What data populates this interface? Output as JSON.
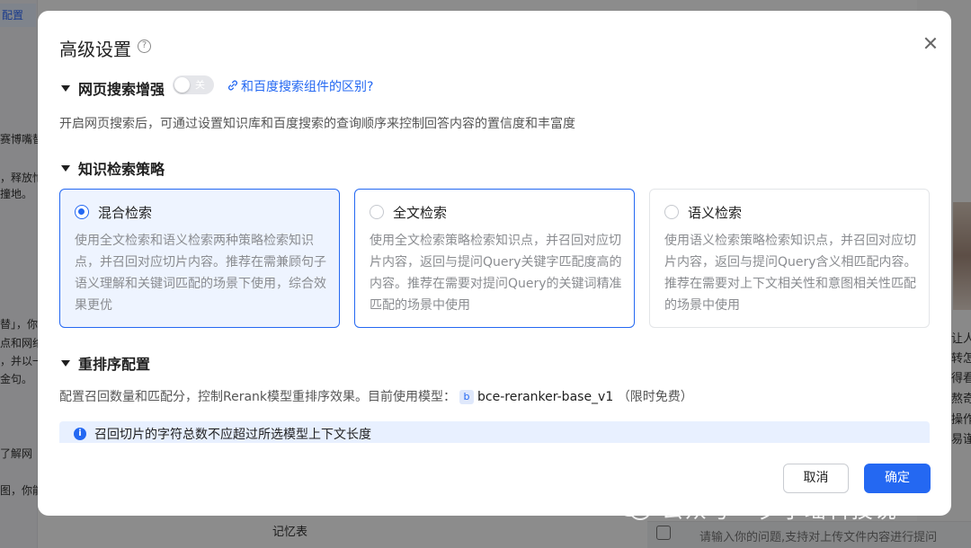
{
  "background": {
    "left_tag": "配置",
    "left_snippets": [
      "赛博嘴替",
      "，释放忙",
      "撞地。",
      "替」，你的",
      "点和网络",
      "，并以一",
      "金句。",
      "了解网",
      "图，你能"
    ],
    "right_snippets": [
      "让人",
      "转怎",
      "得看",
      "熬奇",
      "操作",
      "易谨"
    ],
    "bottom_panel_label": "记忆表",
    "bottom_input_placeholder": "请输入你的问题,支持对上传文件内容进行提问"
  },
  "modal": {
    "title": "高级设置",
    "help_icon_glyph": "?",
    "web_search": {
      "title": "网页搜索增强",
      "toggle_label": "关",
      "toggle_on": false,
      "link_text": "和百度搜索组件的区别?",
      "description": "开启网页搜索后，可通过设置知识库和百度搜索的查询顺序来控制回答内容的置信度和丰富度"
    },
    "retrieval": {
      "title": "知识检索策略",
      "options": [
        {
          "title": "混合检索",
          "selected": true,
          "description": "使用全文检索和语义检索两种策略检索知识点，并召回对应切片内容。推荐在需兼顾句子语义理解和关键词匹配的场景下使用，综合效果更优"
        },
        {
          "title": "全文检索",
          "selected": false,
          "description": "使用全文检索策略检索知识点，并召回对应切片内容，返回与提问Query关键字匹配度高的内容。推荐在需要对提问Query的关键词精准匹配的场景中使用"
        },
        {
          "title": "语义检索",
          "selected": false,
          "description": "使用语义检索策略检索知识点，并召回对应切片内容，返回与提问Query含义相匹配内容。推荐在需要对上下文相关性和意图相关性匹配的场景中使用"
        }
      ]
    },
    "rerank": {
      "title": "重排序配置",
      "description_prefix": "配置召回数量和匹配分，控制Rerank模型重排序效果。目前使用模型：",
      "model_chip": "b",
      "model_name": "bce-reranker-base_v1",
      "model_note": "（限时免费）",
      "info_icon_glyph": "i",
      "info_text": "召回切片的字符总数不应超过所选模型上下文长度"
    },
    "buttons": {
      "cancel": "取消",
      "confirm": "确定"
    }
  },
  "watermark": {
    "text": "公众号 · 夕小瑶科技说"
  },
  "colors": {
    "accent": "#2468f2",
    "selected_card_bg": "#eef4ff",
    "info_bg": "#e8f0ff"
  }
}
